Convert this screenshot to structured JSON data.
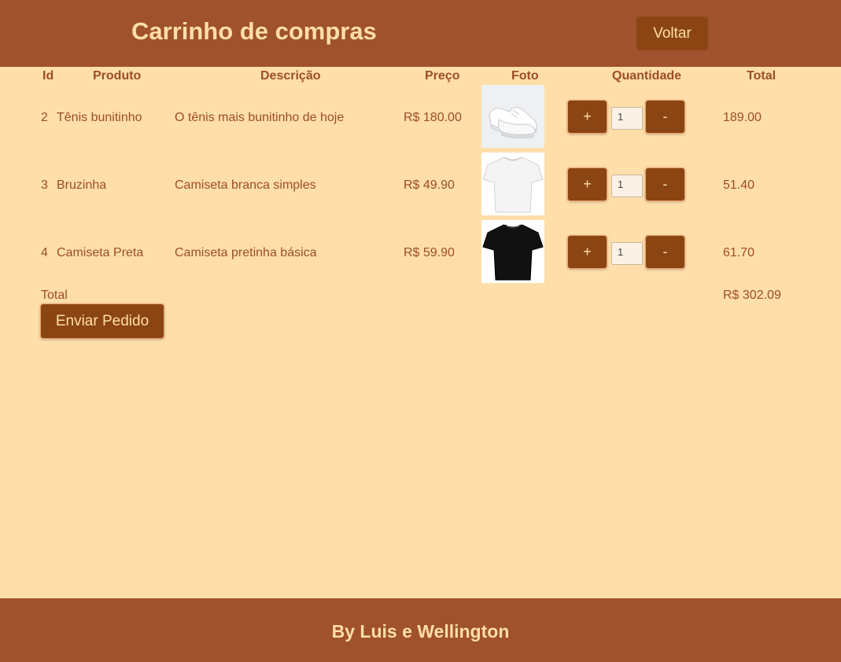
{
  "header": {
    "title": "Carrinho de compras",
    "back_label": "Voltar"
  },
  "table": {
    "columns": {
      "id": "Id",
      "product": "Produto",
      "description": "Descrição",
      "price": "Preço",
      "photo": "Foto",
      "quantity": "Quantidade",
      "total": "Total"
    },
    "rows": [
      {
        "id": "2",
        "product": "Tênis bunitinho",
        "description": "O tênis mais bunitinho de hoje",
        "price": "R$ 180.00",
        "photo": "white-sneaker",
        "plus": "+",
        "minus": "-",
        "quantity": "1",
        "total": "189.00"
      },
      {
        "id": "3",
        "product": "Bruzinha",
        "description": "Camiseta branca simples",
        "price": "R$ 49.90",
        "photo": "white-tshirt",
        "plus": "+",
        "minus": "-",
        "quantity": "1",
        "total": "51.40"
      },
      {
        "id": "4",
        "product": "Camiseta Preta",
        "description": "Camiseta pretinha básica",
        "price": "R$ 59.90",
        "photo": "black-tshirt",
        "plus": "+",
        "minus": "-",
        "quantity": "1",
        "total": "61.70"
      }
    ],
    "total_label": "Total",
    "total_value": "R$ 302.09"
  },
  "send_label": "Enviar Pedido",
  "footer": {
    "credits": "By Luis e Wellington"
  },
  "colors": {
    "background": "#FFDEAA",
    "header_footer": "#A0512D",
    "button": "#8B4513",
    "text": "#9C4D2A"
  }
}
